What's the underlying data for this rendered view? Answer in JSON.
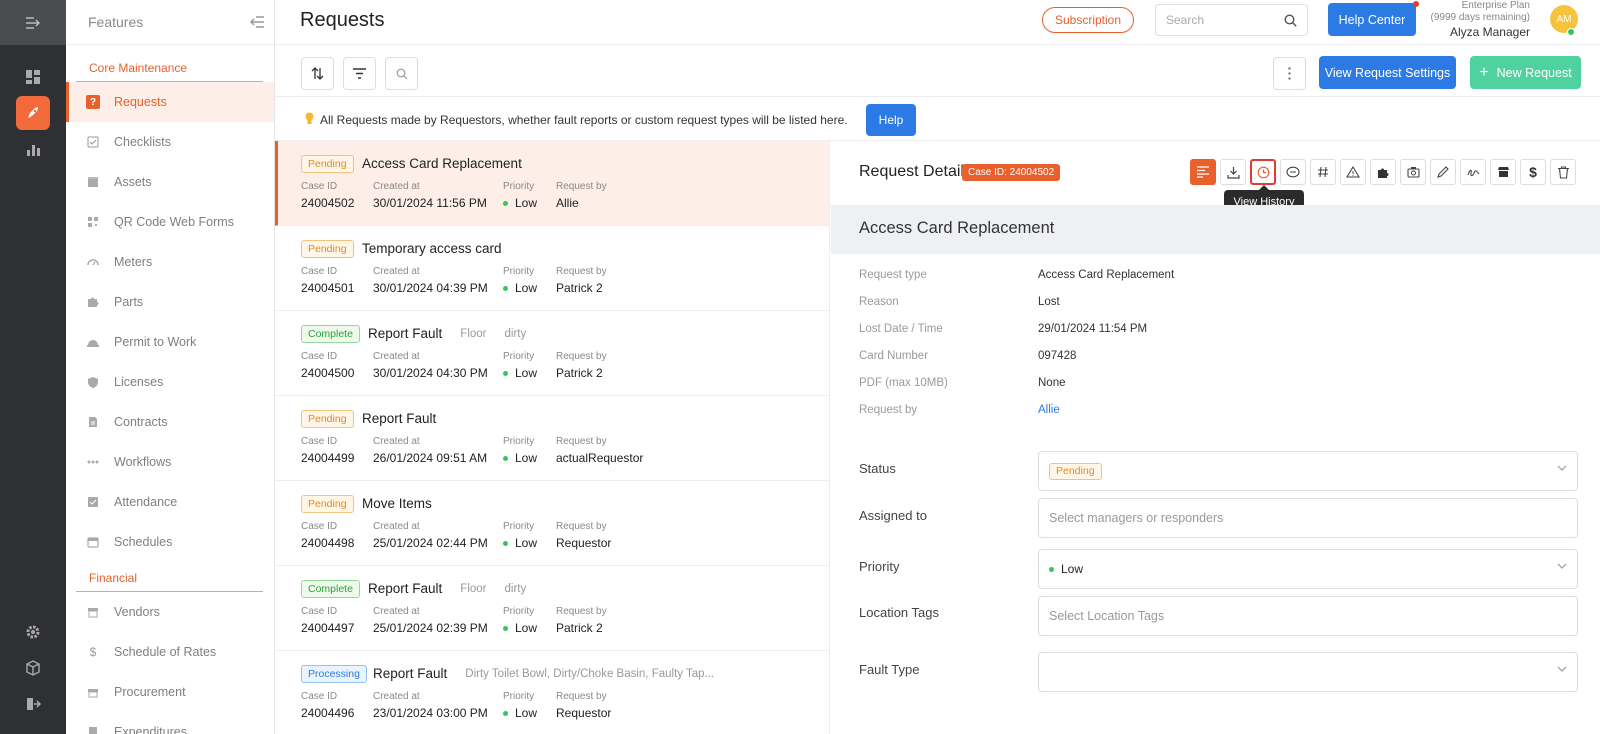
{
  "header": {
    "sidebar_title": "Features",
    "page_title": "Requests",
    "subscription_label": "Subscription",
    "search_placeholder": "Search",
    "help_center_label": "Help Center",
    "plan_name": "Enterprise Plan",
    "plan_remaining": "(9999 days remaining)",
    "user_name": "Alyza Manager",
    "avatar_initials": "AM"
  },
  "sidebar": {
    "sections": [
      {
        "title": "Core Maintenance",
        "items": [
          {
            "label": "Requests",
            "icon": "question-icon",
            "active": true
          },
          {
            "label": "Checklists",
            "icon": "checklist-icon"
          },
          {
            "label": "Assets",
            "icon": "box-icon"
          },
          {
            "label": "QR Code Web Forms",
            "icon": "qr-code-icon"
          },
          {
            "label": "Meters",
            "icon": "gauge-icon"
          },
          {
            "label": "Parts",
            "icon": "puzzle-icon"
          },
          {
            "label": "Permit to Work",
            "icon": "helmet-icon"
          },
          {
            "label": "Licenses",
            "icon": "shield-icon"
          },
          {
            "label": "Contracts",
            "icon": "document-icon"
          },
          {
            "label": "Workflows",
            "icon": "dots-icon"
          },
          {
            "label": "Attendance",
            "icon": "check-square-icon"
          },
          {
            "label": "Schedules",
            "icon": "calendar-icon"
          }
        ]
      },
      {
        "title": "Financial",
        "items": [
          {
            "label": "Vendors",
            "icon": "store-icon"
          },
          {
            "label": "Schedule of Rates",
            "icon": "dollar-icon"
          },
          {
            "label": "Procurement",
            "icon": "cart-icon"
          },
          {
            "label": "Expenditures",
            "icon": "receipt-icon"
          }
        ]
      }
    ]
  },
  "toolbar": {
    "view_settings_label": "View Request Settings",
    "new_request_label": "New Request"
  },
  "info": {
    "text": "All Requests made by Requestors, whether fault reports or custom request types will be listed here.",
    "help_label": "Help"
  },
  "list": {
    "col_case": "Case ID",
    "col_created": "Created at",
    "col_priority": "Priority",
    "col_by": "Request by",
    "rows": [
      {
        "status": "Pending",
        "title": "Access Card Replacement",
        "sub1": "",
        "sub2": "",
        "case_id": "24004502",
        "created": "30/01/2024 11:56 PM",
        "priority": "Low",
        "by": "Allie"
      },
      {
        "status": "Pending",
        "title": "Temporary access card",
        "sub1": "",
        "sub2": "",
        "case_id": "24004501",
        "created": "30/01/2024 04:39 PM",
        "priority": "Low",
        "by": "Patrick 2"
      },
      {
        "status": "Complete",
        "title": "Report Fault",
        "sub1": "Floor",
        "sub2": "dirty",
        "case_id": "24004500",
        "created": "30/01/2024 04:30 PM",
        "priority": "Low",
        "by": "Patrick 2"
      },
      {
        "status": "Pending",
        "title": "Report Fault",
        "sub1": "",
        "sub2": "",
        "case_id": "24004499",
        "created": "26/01/2024 09:51 AM",
        "priority": "Low",
        "by": "actualRequestor"
      },
      {
        "status": "Pending",
        "title": "Move Items",
        "sub1": "",
        "sub2": "",
        "case_id": "24004498",
        "created": "25/01/2024 02:44 PM",
        "priority": "Low",
        "by": "Requestor"
      },
      {
        "status": "Complete",
        "title": "Report Fault",
        "sub1": "Floor",
        "sub2": "dirty",
        "case_id": "24004497",
        "created": "25/01/2024 02:39 PM",
        "priority": "Low",
        "by": "Patrick 2"
      },
      {
        "status": "Processing",
        "title": "Report Fault",
        "sub1": "Dirty Toilet Bowl, Dirty/Choke Basin, Faulty Tap...",
        "sub2": "",
        "case_id": "24004496",
        "created": "23/01/2024 03:00 PM",
        "priority": "Low",
        "by": "Requestor"
      }
    ]
  },
  "detail": {
    "heading": "Request Detail",
    "case_badge": "Case ID: 24004502",
    "tooltip": "View History",
    "title": "Access Card Replacement",
    "fields": [
      {
        "key": "Request type",
        "value": "Access Card Replacement"
      },
      {
        "key": "Reason",
        "value": "Lost"
      },
      {
        "key": "Lost Date / Time",
        "value": "29/01/2024 11:54 PM"
      },
      {
        "key": "Card Number",
        "value": "097428"
      },
      {
        "key": "PDF (max 10MB)",
        "value": "None"
      },
      {
        "key": "Request by",
        "value": "Allie"
      }
    ],
    "status_label": "Status",
    "status_value": "Pending",
    "assigned_label": "Assigned to",
    "assigned_placeholder": "Select managers or responders",
    "priority_label": "Priority",
    "priority_value": "Low",
    "location_label": "Location Tags",
    "location_placeholder": "Select Location Tags",
    "fault_label": "Fault Type",
    "fault_value": ""
  },
  "colors": {
    "accent": "#e8602c",
    "primary_blue": "#2c7be5",
    "new_green": "#4fd1a0"
  }
}
